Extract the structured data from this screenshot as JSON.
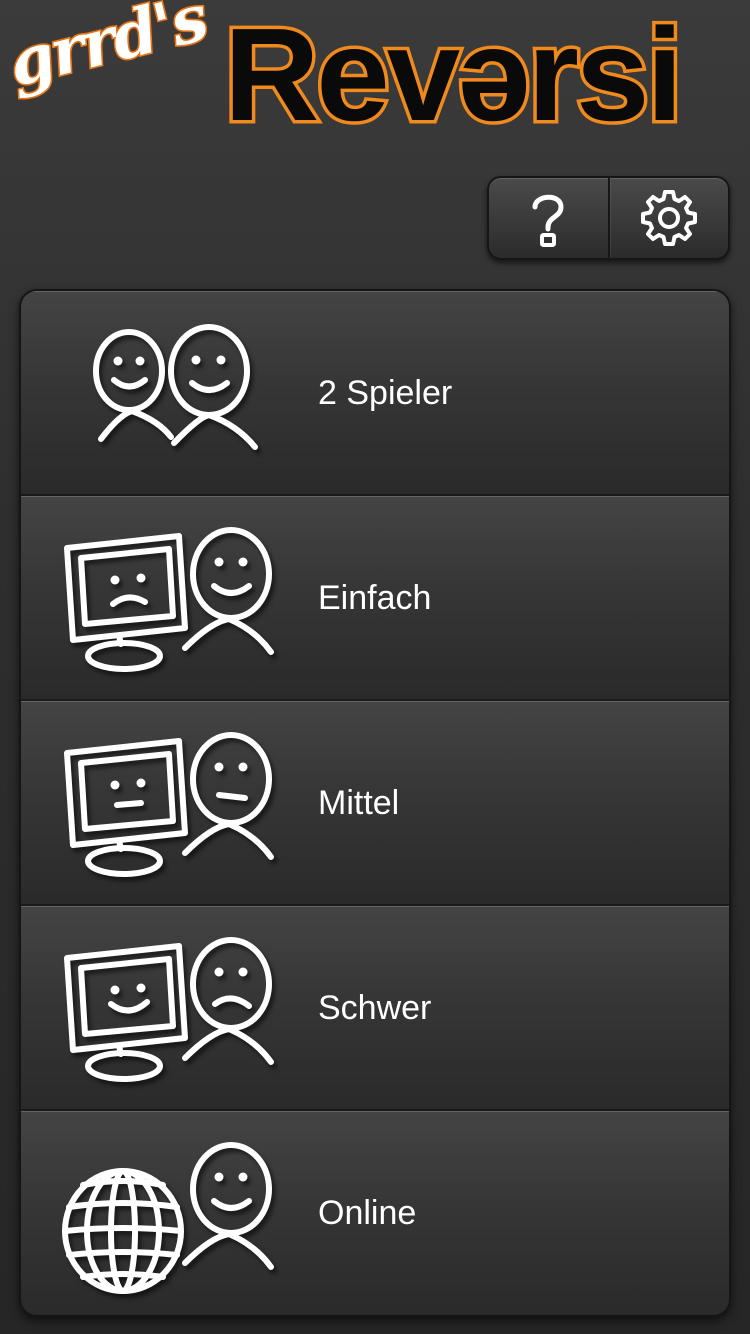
{
  "app": {
    "logo_prefix": "grrd's",
    "logo_title": "Reversi",
    "logo_title_start": "Rev",
    "logo_title_mid": "ə",
    "logo_title_end": "rsi"
  },
  "toolbar": {
    "help_icon": "question-mark-icon",
    "settings_icon": "gear-icon"
  },
  "menu": {
    "items": [
      {
        "label": "2 Spieler",
        "icon": "two-players-icon"
      },
      {
        "label": "Einfach",
        "icon": "computer-sad-vs-player-icon"
      },
      {
        "label": "Mittel",
        "icon": "computer-neutral-vs-player-icon"
      },
      {
        "label": "Schwer",
        "icon": "computer-happy-vs-player-sad-icon"
      },
      {
        "label": "Online",
        "icon": "globe-vs-player-icon"
      }
    ]
  },
  "colors": {
    "background": "#2e2e2e",
    "logo_outline": "#f08a1c",
    "text": "#ffffff"
  }
}
